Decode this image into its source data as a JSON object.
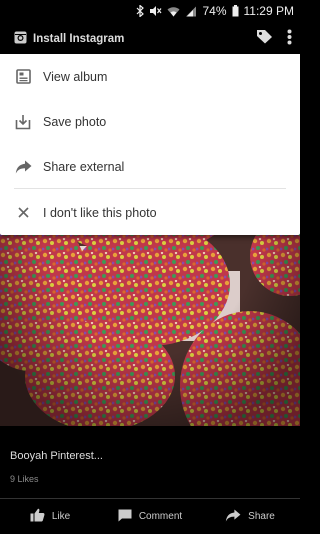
{
  "status_bar": {
    "battery": "74%",
    "time": "11:29 PM",
    "icons": [
      "bluetooth-icon",
      "mute-icon",
      "wifi-icon",
      "signal-icon",
      "battery-icon"
    ]
  },
  "top_bar": {
    "install_label": "Install Instagram",
    "icons": [
      "instagram-icon",
      "tag-icon",
      "more-vert-icon"
    ]
  },
  "menu": {
    "items": [
      {
        "label": "View album",
        "icon": "album-icon"
      },
      {
        "label": "Save photo",
        "icon": "download-icon"
      },
      {
        "label": "Share external",
        "icon": "share-arrow-icon"
      },
      {
        "label": "I don't like this photo",
        "icon": "close-icon"
      }
    ]
  },
  "post": {
    "caption": "Booyah Pinterest...",
    "likes": "9 Likes"
  },
  "actions": [
    {
      "label": "Like",
      "icon": "thumbs-up-icon"
    },
    {
      "label": "Comment",
      "icon": "comment-icon"
    },
    {
      "label": "Share",
      "icon": "share-arrow-icon"
    }
  ],
  "colors": {
    "menu_bg": "#ffffff",
    "menu_text": "#333333",
    "menu_icon": "#666666",
    "background": "#000000"
  }
}
